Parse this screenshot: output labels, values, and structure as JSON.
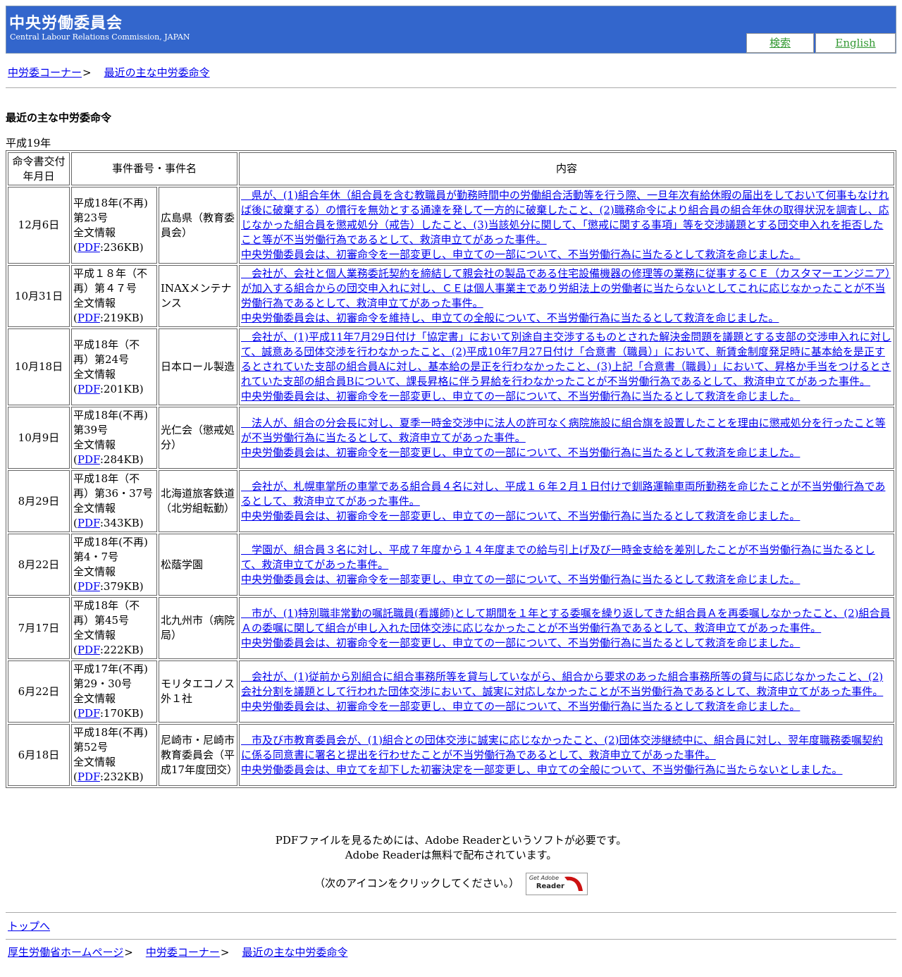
{
  "header": {
    "title": "中央労働委員会",
    "subtitle": "Central Labour Relations Commission, JAPAN",
    "search_label": "検索",
    "english_label": "English",
    "colors": {
      "header_bg": "#3366cc",
      "header_button_link": "#339933"
    }
  },
  "breadcrumb_top": [
    {
      "label": "中労委コーナー",
      "sep": ">"
    },
    {
      "label": "最近の主な中労委命令",
      "sep": ""
    }
  ],
  "page_title": "最近の主な中労委命令",
  "year_label": "平成19年",
  "table": {
    "headers": [
      "命令書交付年月日",
      "事件番号・事件名",
      "内容"
    ],
    "rows": [
      {
        "date": "12月6日",
        "case_no": "平成18年(不再)第23号",
        "full_text": "全文情報",
        "pdf_label": "PDF",
        "pdf_size": ":236KB)",
        "name": "広島県（教育委員会）",
        "content": "　県が、(1)組合年休（組合員を含む教職員が勤務時間中の労働組合活動等を行う際、一旦年次有給休暇の届出をしておいて何事もなければ後に破棄する）の慣行を無効とする通達を発して一方的に破棄したこと、(2)職務命令により組合員の組合年休の取得状況を調査し、応じなかった組合員を懲戒処分（戒告）したこと、(3)当該処分に関して、「懲戒に関する事項」等を交渉議題とする団交申入れを拒否したこと等が不当労働行為であるとして、救済申立てがあった事件。",
        "decision": "中央労働委員会は、初審命令を一部変更し、申立ての一部について、不当労働行為に当たるとして救済を命じました。"
      },
      {
        "date": "10月31日",
        "case_no": "平成１８年（不再）第４７号",
        "full_text": "全文情報",
        "pdf_label": "PDF",
        "pdf_size": ":219KB)",
        "name": "INAXメンテナンス",
        "content": "　会社が、会社と個人業務委託契約を締結して親会社の製品である住宅設備機器の修理等の業務に従事するＣＥ（カスタマーエンジニア）が加入する組合からの団交申入れに対し、ＣＥは個人事業主であり労組法上の労働者に当たらないとしてこれに応じなかったことが不当労働行為であるとして、救済申立てがあった事件。",
        "decision": "中央労働委員会は、初審命令を維持し、申立ての全般について、不当労働行為に当たるとして救済を命じました。"
      },
      {
        "date": "10月18日",
        "case_no": "平成18年（不再）第24号",
        "full_text": "全文情報",
        "pdf_label": "PDF",
        "pdf_size": ":201KB)",
        "name": "日本ロール製造",
        "content": "　会社が、(1)平成11年7月29日付け「協定書」において別途自主交渉するものとされた解決金問題を議題とする支部の交渉申入れに対して、誠意ある団体交渉を行わなかったこと、(2)平成10年7月27日付け「合意書（職員）」において、新賃金制度発足時に基本給を是正するとされていた支部の組合員Aに対し、基本給の是正を行わなかったこと、(3)上記「合意書（職員）」において、昇格か手当をつけるとされていた支部の組合員Bについて、課長昇格に伴う昇給を行わなかったことが不当労働行為であるとして、救済申立てがあった事件。",
        "decision": "中央労働委員会は、初審命令を一部変更し、申立ての一部について、不当労働行為に当たるとして救済を命じました。"
      },
      {
        "date": "10月9日",
        "case_no": "平成18年(不再)第39号",
        "full_text": "全文情報",
        "pdf_label": "PDF",
        "pdf_size": ":284KB)",
        "name": "光仁会（懲戒処分）",
        "content": "　法人が、組合の分会長に対し、夏季一時金交渉中に法人の許可なく病院施設に組合旗を設置したことを理由に懲戒処分を行ったこと等が不当労働行為に当たるとして、救済申立てがあった事件。",
        "decision": "中央労働委員会は、初審命令を一部変更し、申立ての一部について、不当労働行為に当たるとして救済を命じました。"
      },
      {
        "date": "8月29日",
        "case_no": "平成18年（不再）第36・37号",
        "full_text": "全文情報",
        "pdf_label": "PDF",
        "pdf_size": ":343KB)",
        "name": "北海道旅客鉄道（北労組転勤）",
        "content": "　会社が、札幌車掌所の車掌である組合員４名に対し、平成１６年２月１日付けで釧路運輸車両所勤務を命じたことが不当労働行為であるとして、救済申立てがあった事件。",
        "decision": "中央労働委員会は、初審命令を一部変更し、申立ての一部について、不当労働行為に当たるとして救済を命じました。"
      },
      {
        "date": "8月22日",
        "case_no": "平成18年(不再)第4・7号",
        "full_text": "全文情報",
        "pdf_label": "PDF",
        "pdf_size": ":379KB)",
        "name": "松蔭学園",
        "content": "　学園が、組合員３名に対し、平成７年度から１４年度までの給与引上げ及び一時金支給を差別したことが不当労働行為に当たるとして、救済申立てがあった事件。",
        "decision": "中央労働委員会は、初審命令を一部変更し、申立ての一部について、不当労働行為に当たるとして救済を命じました。"
      },
      {
        "date": "7月17日",
        "case_no": "平成18年（不再）第45号",
        "full_text": "全文情報",
        "pdf_label": "PDF",
        "pdf_size": ":222KB)",
        "name": "北九州市（病院局）",
        "content": "　市が、(1)特別職非常勤の嘱託職員(看護師)として期間を１年とする委嘱を繰り返してきた組合員Ａを再委嘱しなかったこと、(2)組合員Ａの委嘱に関して組合が申し入れた団体交渉に応じなかったことが不当労働行為であるとして、救済申立てがあった事件。",
        "decision": "中央労働委員会は、初審命令を一部変更し、申立ての一部について、不当労働行為に当たるとして救済を命じました。"
      },
      {
        "date": "6月22日",
        "case_no": "平成17年(不再)第29・30号",
        "full_text": "全文情報",
        "pdf_label": "PDF",
        "pdf_size": ":170KB)",
        "name": "モリタエコノス外１社",
        "content": "　会社が、(1)従前から別組合に組合事務所等を貸与していながら、組合から要求のあった組合事務所等の貸与に応じなかったこと、(2)会社分割を議題として行われた団体交渉において、誠実に対応しなかったことが不当労働行為であるとして、救済申立てがあった事件。",
        "decision": "中央労働委員会は、初審命令を一部変更し、申立ての一部について、不当労働行為に当たるとして救済を命じました。"
      },
      {
        "date": "6月18日",
        "case_no": "平成18年(不再)第52号",
        "full_text": "全文情報",
        "pdf_label": "PDF",
        "pdf_size": ":232KB)",
        "name": "尼崎市・尼崎市教育委員会（平成17年度団交）",
        "content": "　市及び市教育委員会が、(1)組合との団体交渉に誠実に応じなかったこと、(2)団体交渉継続中に、組合員に対し、翌年度職務委嘱契約に係る同意書に署名と提出を行わせたことが不当労働行為であるとして、救済申立てがあった事件。",
        "decision": "中央労働委員会は、申立てを却下した初審決定を一部変更し、申立ての全般について、不当労働行為に当たらないとしました。"
      }
    ]
  },
  "pdf_note": {
    "line1": "PDFファイルを見るためには、Adobe Readerというソフトが必要です。",
    "line2": "Adobe Readerは無料で配布されています。",
    "click_note": "（次のアイコンをクリックしてください。）",
    "badge_get": "Get Adobe",
    "badge_reader": "Reader"
  },
  "to_top": "トップへ",
  "breadcrumb_bottom": [
    {
      "label": "厚生労働省ホームページ",
      "sep": ">"
    },
    {
      "label": "中労委コーナー",
      "sep": ">"
    },
    {
      "label": "最近の主な中労委命令",
      "sep": ""
    }
  ]
}
